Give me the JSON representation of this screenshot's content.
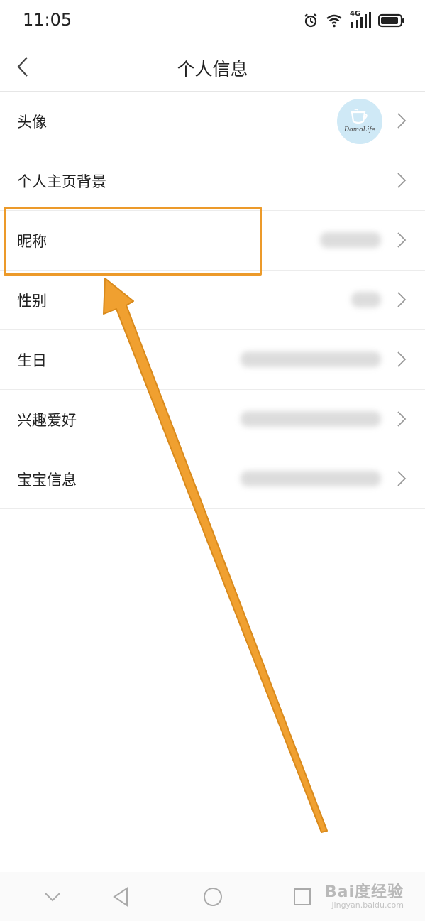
{
  "status_bar": {
    "time": "11:05",
    "network": "4G",
    "icons": [
      "alarm-icon",
      "wifi-icon",
      "signal-icon",
      "battery-icon"
    ]
  },
  "nav": {
    "title": "个人信息",
    "back_icon": "chevron-left-icon"
  },
  "items": [
    {
      "label": "头像",
      "type": "avatar",
      "avatar_text": "DomoLife"
    },
    {
      "label": "个人主页背景",
      "type": "none"
    },
    {
      "label": "昵称",
      "type": "blurred"
    },
    {
      "label": "性别",
      "type": "blurred"
    },
    {
      "label": "生日",
      "type": "blurred"
    },
    {
      "label": "兴趣爱好",
      "type": "blurred"
    },
    {
      "label": "宝宝信息",
      "type": "blurred"
    }
  ],
  "annotation": {
    "color": "#ec9a2a",
    "highlighted_item": "昵称"
  },
  "bottom_nav": [
    "chevron-down-icon",
    "back-triangle-icon",
    "home-circle-icon",
    "recent-square-icon"
  ],
  "watermark": {
    "main": "Bai度经验",
    "sub": "jingyan.baidu.com"
  }
}
